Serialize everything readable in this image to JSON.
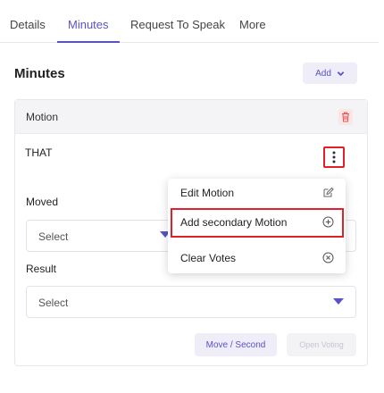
{
  "tabs": [
    {
      "label": "Details",
      "active": false
    },
    {
      "label": "Minutes",
      "active": true
    },
    {
      "label": "Request To Speak",
      "active": false
    },
    {
      "label": "More",
      "active": false
    }
  ],
  "section": {
    "title": "Minutes",
    "add_label": "Add"
  },
  "card": {
    "header_label": "Motion",
    "motion_text": "THAT",
    "moved_label": "Moved",
    "moved_select": "Select",
    "result_label": "Result",
    "result_select": "Select",
    "move_second_label": "Move / Second",
    "open_voting_label": "Open Voting"
  },
  "context_menu": {
    "items": [
      {
        "label": "Edit Motion",
        "icon": "edit-icon"
      },
      {
        "label": "Add secondary Motion",
        "icon": "plus-circle-icon"
      },
      {
        "label": "Clear Votes",
        "icon": "x-circle-icon"
      }
    ]
  },
  "colors": {
    "accent": "#5a52c7",
    "highlight_border": "#e0202a",
    "trash": "#e05a5a"
  }
}
